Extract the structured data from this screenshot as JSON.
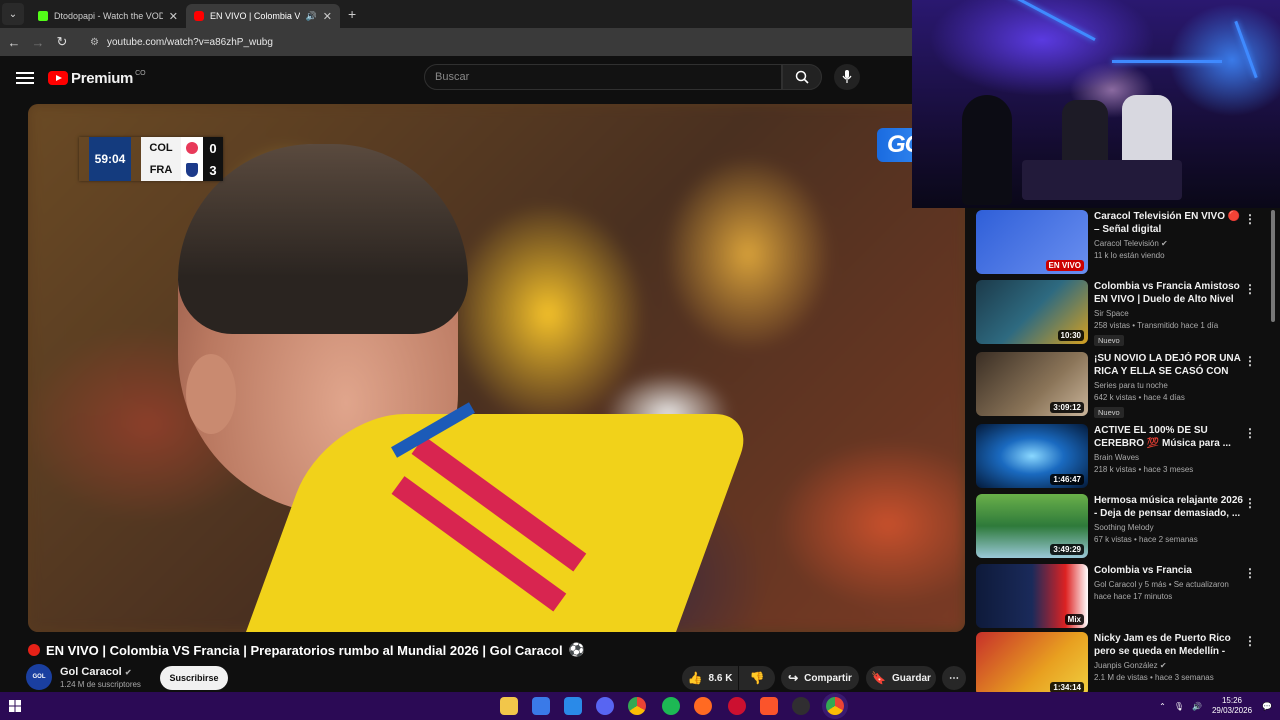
{
  "browser": {
    "tabs": [
      {
        "title": "Dtodopapi - Watch the VOD o",
        "favicon_color": "#53fc18"
      },
      {
        "title": "EN VIVO | Colombia VS F",
        "favicon_color": "#ff0000"
      }
    ],
    "url": "youtube.com/watch?v=a86zhP_wubg"
  },
  "youtube": {
    "logo_text": "Premium",
    "region": "CO",
    "search_placeholder": "Buscar"
  },
  "scoreboard": {
    "clock": "59:04",
    "team1": "COL",
    "team2": "FRA",
    "score1": "0",
    "score2": "3",
    "broadcaster": "GOL"
  },
  "video": {
    "title": "EN VIVO | Colombia VS Francia | Preparatorios rumbo al Mundial 2026 | Gol Caracol",
    "title_emoji": "⚽",
    "channel": "Gol Caracol",
    "subscribers": "1.24 M de suscriptores",
    "subscribe_label": "Suscribirse",
    "likes": "8.6 K",
    "share_label": "Compartir",
    "save_label": "Guardar"
  },
  "recommendations": [
    {
      "title": "Caracol Televisión EN VIVO 🔴 – Señal digital",
      "channel": "Caracol Televisión",
      "verified": true,
      "stats": "11 k lo están viendo",
      "badge_live": "EN VIVO",
      "thumb_color": "#2f5fd8"
    },
    {
      "title": "Colombia vs Francia Amistoso EN VIVO | Duelo de Alto Nivel ...",
      "channel": "Sir Space",
      "stats": "258 vistas • Transmitido hace 1 día",
      "tag": "Nuevo",
      "duration": "10:30",
      "thumb_color": "#1c3a4a"
    },
    {
      "title": "¡SU NOVIO LA DEJÓ POR UNA RICA Y ELLA SE CASÓ CON U...",
      "channel": "Series para tu noche",
      "stats": "642 k vistas • hace 4 días",
      "tag": "Nuevo",
      "duration": "3:09:12",
      "thumb_color": "#5a4a38"
    },
    {
      "title": "ACTIVE EL 100% DE SU CEREBRO 💯 Música para ...",
      "channel": "Brain Waves",
      "stats": "218 k vistas • hace 3 meses",
      "duration": "1:46:47",
      "thumb_color": "#0a4a8a"
    },
    {
      "title": "Hermosa música relajante 2026 - Deja de pensar demasiado, ...",
      "channel": "Soothing Melody",
      "stats": "67 k vistas • hace 2 semanas",
      "duration": "3:49:29",
      "thumb_color": "#2e7a3a"
    },
    {
      "title": "Colombia vs Francia",
      "channel": "Gol Caracol y 5 más • Se actualizaron",
      "stats": "hace hace 17 minutos",
      "duration": "Mix",
      "thumb_color": "#1a2a5a"
    },
    {
      "title": "Nicky Jam es de Puerto Rico pero se queda en Medellín - Th...",
      "channel": "Juanpis González",
      "verified": true,
      "stats": "2.1 M de vistas • hace 3 semanas",
      "duration": "1:34:14",
      "thumb_color": "#c7302a"
    }
  ],
  "taskbar": {
    "time": "15:26",
    "date": "29/03/2026"
  }
}
